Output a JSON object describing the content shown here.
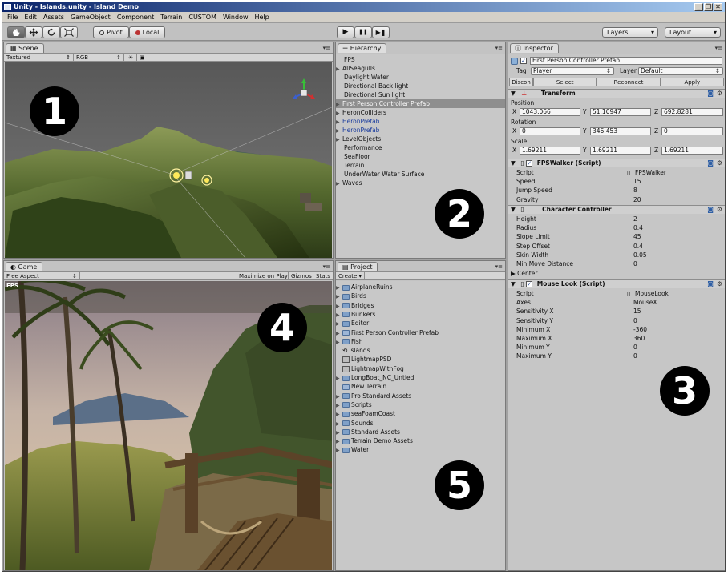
{
  "window": {
    "title": "Unity - Islands.unity - Island Demo",
    "controls": [
      "_",
      "❐",
      "✕"
    ]
  },
  "menu": [
    "File",
    "Edit",
    "Assets",
    "GameObject",
    "Component",
    "Terrain",
    "CUSTOM",
    "Window",
    "Help"
  ],
  "toolbar": {
    "tools": [
      "hand",
      "move",
      "rotate",
      "scale"
    ],
    "pivot": "Pivot",
    "local": "Local",
    "play": "▶",
    "pause": "❚❚",
    "step": "▶❚",
    "layers": "Layers",
    "layout": "Layout"
  },
  "scene": {
    "tab": "Scene",
    "render_mode": "Textured",
    "color_mode": "RGB",
    "badge": "1"
  },
  "game": {
    "tab": "Game",
    "aspect": "Free Aspect",
    "options": [
      "Maximize on Play",
      "Gizmos",
      "Stats"
    ],
    "fps_label": "FPS",
    "badge": "4"
  },
  "hierarchy": {
    "tab": "Hierarchy",
    "badge": "2",
    "items": [
      {
        "label": "FPS",
        "arrow": false,
        "selected": false,
        "blue": false
      },
      {
        "label": "AllSeagulls",
        "arrow": true,
        "selected": false,
        "blue": false
      },
      {
        "label": "Daylight Water",
        "arrow": false,
        "selected": false,
        "blue": false
      },
      {
        "label": "Directional Back light",
        "arrow": false,
        "selected": false,
        "blue": false
      },
      {
        "label": "Directional Sun light",
        "arrow": false,
        "selected": false,
        "blue": false
      },
      {
        "label": "First Person Controller Prefab",
        "arrow": true,
        "selected": true,
        "blue": false
      },
      {
        "label": "HeronColliders",
        "arrow": true,
        "selected": false,
        "blue": false
      },
      {
        "label": "HeronPrefab",
        "arrow": true,
        "selected": false,
        "blue": true
      },
      {
        "label": "HeronPrefab",
        "arrow": true,
        "selected": false,
        "blue": true
      },
      {
        "label": "LevelObjects",
        "arrow": true,
        "selected": false,
        "blue": false
      },
      {
        "label": "Performance",
        "arrow": false,
        "selected": false,
        "blue": false
      },
      {
        "label": "SeaFloor",
        "arrow": false,
        "selected": false,
        "blue": false
      },
      {
        "label": "Terrain",
        "arrow": false,
        "selected": false,
        "blue": false
      },
      {
        "label": "UnderWater Water Surface",
        "arrow": false,
        "selected": false,
        "blue": false
      },
      {
        "label": "Waves",
        "arrow": true,
        "selected": false,
        "blue": false
      }
    ]
  },
  "project": {
    "tab": "Project",
    "create": "Create",
    "badge": "5",
    "items": [
      {
        "label": "AirplaneRuins",
        "kind": "folder",
        "arrow": true
      },
      {
        "label": "Birds",
        "kind": "folder",
        "arrow": true
      },
      {
        "label": "Bridges",
        "kind": "folder",
        "arrow": true
      },
      {
        "label": "Bunkers",
        "kind": "folder",
        "arrow": true
      },
      {
        "label": "Editor",
        "kind": "folder",
        "arrow": true
      },
      {
        "label": "First Person Controller Prefab",
        "kind": "prefab",
        "arrow": true
      },
      {
        "label": "Fish",
        "kind": "folder",
        "arrow": true
      },
      {
        "label": "Islands",
        "kind": "scene",
        "arrow": false
      },
      {
        "label": "LightmapPSD",
        "kind": "image",
        "arrow": false
      },
      {
        "label": "LightmapWithFog",
        "kind": "image",
        "arrow": false
      },
      {
        "label": "LongBoat_NC_Untied",
        "kind": "folder",
        "arrow": true
      },
      {
        "label": "New Terrain",
        "kind": "prefab",
        "arrow": false
      },
      {
        "label": "Pro Standard Assets",
        "kind": "folder",
        "arrow": true
      },
      {
        "label": "Scripts",
        "kind": "folder",
        "arrow": true
      },
      {
        "label": "seaFoamCoast",
        "kind": "folder",
        "arrow": true
      },
      {
        "label": "Sounds",
        "kind": "folder",
        "arrow": true
      },
      {
        "label": "Standard Assets",
        "kind": "folder",
        "arrow": true
      },
      {
        "label": "Terrain Demo Assets",
        "kind": "folder",
        "arrow": true
      },
      {
        "label": "Water",
        "kind": "folder",
        "arrow": true
      }
    ]
  },
  "inspector": {
    "tab": "Inspector",
    "badge": "3",
    "object_name": "First Person Controller Prefab",
    "tag_label": "Tag",
    "tag_value": "Player",
    "layer_label": "Layer",
    "layer_value": "Default",
    "prefab_buttons": [
      "Disconnect",
      "Select",
      "Reconnect",
      "Apply"
    ],
    "disconnect_short": "Discon",
    "transform": {
      "title": "Transform",
      "position_label": "Position",
      "position": {
        "x": "1043.066",
        "y": "51.10947",
        "z": "692.8281"
      },
      "rotation_label": "Rotation",
      "rotation": {
        "x": "0",
        "y": "346.453",
        "z": "0"
      },
      "scale_label": "Scale",
      "scale": {
        "x": "1.69211",
        "y": "1.69211",
        "z": "1.69211"
      }
    },
    "fpswalker": {
      "title": "FPSWalker (Script)",
      "rows": [
        {
          "label": "Script",
          "value": "FPSWalker"
        },
        {
          "label": "Speed",
          "value": "15"
        },
        {
          "label": "Jump Speed",
          "value": "8"
        },
        {
          "label": "Gravity",
          "value": "20"
        }
      ]
    },
    "character_controller": {
      "title": "Character Controller",
      "rows": [
        {
          "label": "Height",
          "value": "2"
        },
        {
          "label": "Radius",
          "value": "0.4"
        },
        {
          "label": "Slope Limit",
          "value": "45"
        },
        {
          "label": "Step Offset",
          "value": "0.4"
        },
        {
          "label": "Skin Width",
          "value": "0.05"
        },
        {
          "label": "Min Move Distance",
          "value": "0"
        }
      ],
      "center_label": "Center"
    },
    "mouselook": {
      "title": "Mouse Look (Script)",
      "rows": [
        {
          "label": "Script",
          "value": "MouseLook"
        },
        {
          "label": "Axes",
          "value": "MouseX"
        },
        {
          "label": "Sensitivity X",
          "value": "15"
        },
        {
          "label": "Sensitivity Y",
          "value": "0"
        },
        {
          "label": "Minimum X",
          "value": "-360"
        },
        {
          "label": "Maximum X",
          "value": "360"
        },
        {
          "label": "Minimum Y",
          "value": "0"
        },
        {
          "label": "Maximum Y",
          "value": "0"
        }
      ]
    }
  },
  "colors": {
    "selection": "#8e8e8e",
    "prefab_text": "#1b3d9e",
    "badge": "#000000"
  }
}
